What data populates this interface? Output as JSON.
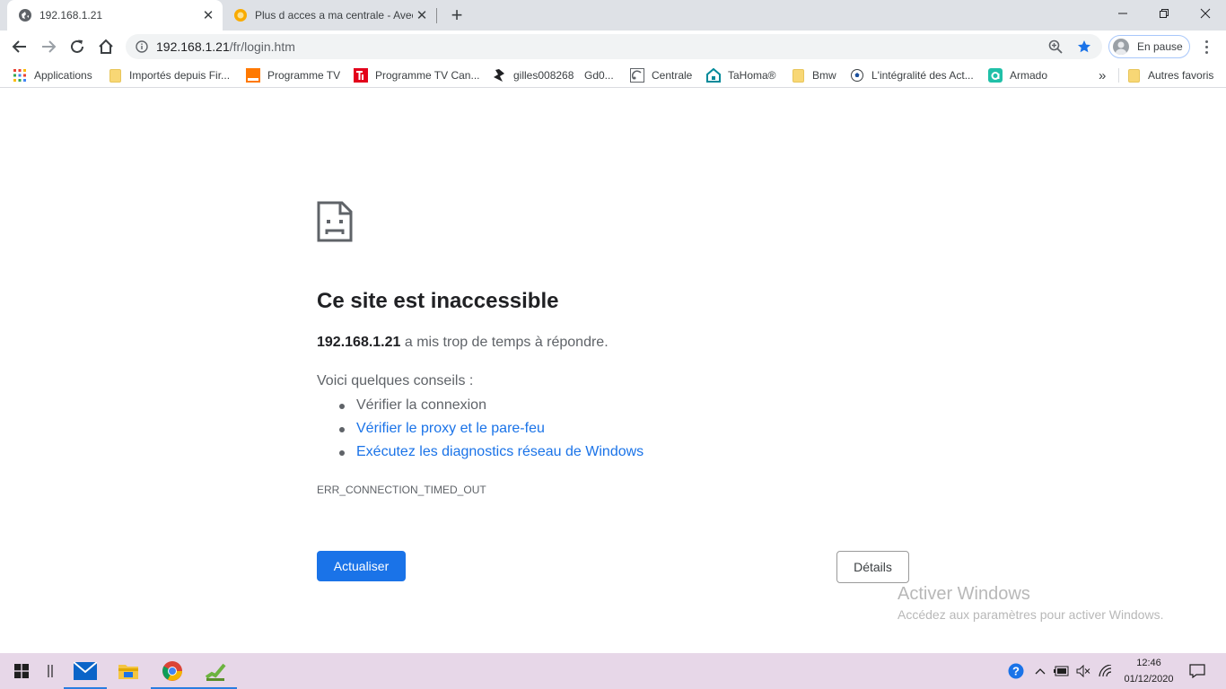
{
  "tabs": [
    {
      "title": "192.168.1.21",
      "active": true
    },
    {
      "title": "Plus d acces a ma centrale - Avec",
      "active": false
    }
  ],
  "window_controls": {
    "minimize": "minimize",
    "maximize": "restore",
    "close": "close"
  },
  "omnibox": {
    "host": "192.168.1.21",
    "path": "/fr/login.htm"
  },
  "profile": {
    "label": "En pause"
  },
  "bookmarks": [
    {
      "label": "Applications",
      "icon": "apps-grid-icon"
    },
    {
      "label": "Importés depuis Fir...",
      "icon": "folder-icon"
    },
    {
      "label": "Programme TV",
      "icon": "orange-icon"
    },
    {
      "label": "Programme TV Can...",
      "icon": "telerama-icon"
    },
    {
      "label": "gilles008268",
      "icon": "black-logo-icon"
    },
    {
      "label": "Gd0...",
      "icon": "none"
    },
    {
      "label": "Centrale",
      "icon": "centrale-icon"
    },
    {
      "label": "TaHoma®",
      "icon": "tahoma-icon"
    },
    {
      "label": "Bmw",
      "icon": "folder-icon"
    },
    {
      "label": "L'intégralité des Act...",
      "icon": "soccer-icon"
    },
    {
      "label": "Armado",
      "icon": "armado-icon"
    },
    {
      "label": "Autres favoris",
      "icon": "folder-icon"
    }
  ],
  "error": {
    "heading": "Ce site est inaccessible",
    "host": "192.168.1.21",
    "summary_rest": " a mis trop de temps à répondre.",
    "tips_title": "Voici quelques conseils :",
    "tips": [
      {
        "text": "Vérifier la connexion",
        "link": false
      },
      {
        "text": "Vérifier le proxy et le pare-feu",
        "link": true
      },
      {
        "text": "Exécutez les diagnostics réseau de Windows",
        "link": true
      }
    ],
    "code": "ERR_CONNECTION_TIMED_OUT",
    "reload_label": "Actualiser",
    "details_label": "Détails"
  },
  "watermark": {
    "title": "Activer Windows",
    "subtitle": "Accédez aux paramètres pour activer Windows."
  },
  "taskbar": {
    "time": "12:46",
    "date": "01/12/2020"
  },
  "colors": {
    "accent": "#1a73e8",
    "taskbar": "#e7d7e8",
    "tabstrip": "#dee1e6"
  }
}
